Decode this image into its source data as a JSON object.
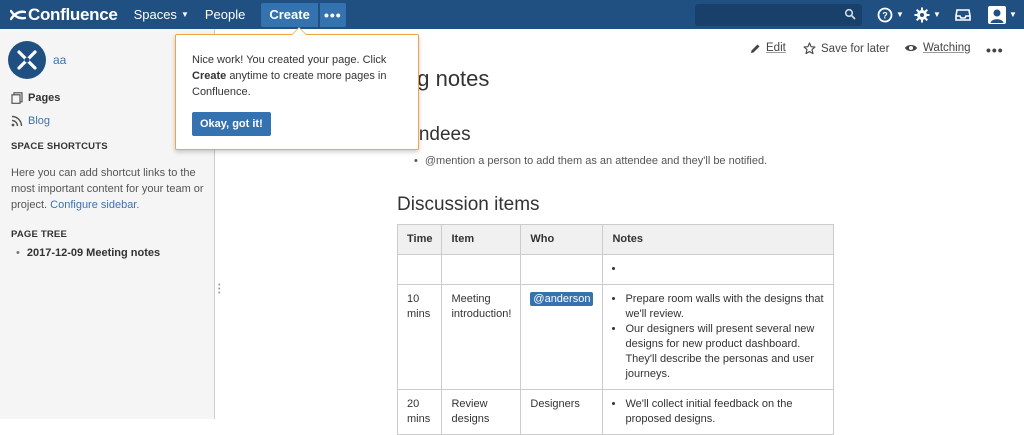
{
  "topnav": {
    "logo": "Confluence",
    "spaces": "Spaces",
    "people": "People",
    "create": "Create",
    "more": "•••"
  },
  "sidebar": {
    "space_name": "aa",
    "pages": "Pages",
    "blog": "Blog",
    "shortcuts_heading": "SPACE SHORTCUTS",
    "shortcuts_text": "Here you can add shortcut links to the most important content for your team or project.",
    "configure_link": "Configure sidebar.",
    "page_tree_heading": "PAGE TREE",
    "tree_item": "2017-12-09 Meeting notes"
  },
  "page_actions": {
    "edit": "Edit",
    "save_for_later": "Save for later",
    "watching": "Watching"
  },
  "content": {
    "title": "ng notes",
    "attendees_heading": "tendees",
    "attendee_hint": "@mention a person to add them as an attendee and they'll be notified.",
    "discussion_heading": "Discussion items",
    "table": {
      "headers": [
        "Time",
        "Item",
        "Who",
        "Notes"
      ],
      "rows": [
        {
          "time": "",
          "item": "",
          "who": "",
          "notes": [
            ""
          ]
        },
        {
          "time": "10 mins",
          "item": "Meeting introduction!",
          "who": "@anderson",
          "notes": [
            "Prepare room walls with the designs that we'll review.",
            "Our designers will present several new designs for new product dashboard. They'll describe the personas and user journeys."
          ]
        },
        {
          "time": "20 mins",
          "item": "Review designs",
          "who": "Designers",
          "notes": [
            "We'll collect initial feedback on the proposed designs."
          ]
        }
      ]
    }
  },
  "popup": {
    "text_before": "Nice work! You created your page. Click",
    "text_bold": "Create",
    "text_after": "anytime to create more pages in Confluence.",
    "button": "Okay, got it!"
  },
  "colors": {
    "nav_bg": "#205081",
    "button_blue": "#3572b0",
    "link": "#3b73af",
    "popup_border": "#f0a742"
  }
}
